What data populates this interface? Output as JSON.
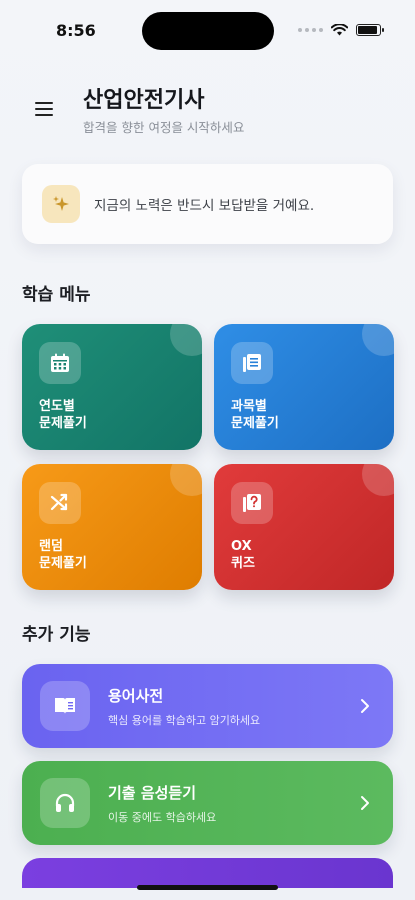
{
  "status_bar": {
    "time": "8:56",
    "icons": [
      "signal-icon",
      "wifi-icon",
      "battery-icon"
    ],
    "battery_level": 0.9
  },
  "header": {
    "title": "산업안전기사",
    "subtitle": "합격을 향한 여정을 시작하세요",
    "menu_icon": "menu-icon"
  },
  "quote": {
    "text": "지금의 노력은 반드시 보답받을 거예요.",
    "icon": "sparkles-icon",
    "icon_color": "#c9962b"
  },
  "study_menu": {
    "title": "학습 메뉴",
    "tiles": [
      {
        "label": "연도별\n문제풀기",
        "icon": "calendar-icon",
        "colors": [
          "#1f8f78",
          "#127466"
        ]
      },
      {
        "label": "과목별\n문제풀기",
        "icon": "book-list-icon",
        "colors": [
          "#2f8ee6",
          "#1d6fc4"
        ]
      },
      {
        "label": "랜덤\n문제풀기",
        "icon": "shuffle-icon",
        "colors": [
          "#f79a18",
          "#df7d00"
        ]
      },
      {
        "label": "OX\n퀴즈",
        "icon": "quiz-icon",
        "colors": [
          "#e13b3b",
          "#c02727"
        ]
      }
    ]
  },
  "extra": {
    "title": "추가 기능",
    "items": [
      {
        "title": "용어사전",
        "subtitle": "핵심 용어를 학습하고 암기하세요",
        "icon": "dictionary-icon",
        "colors": [
          "#6a63f0",
          "#7d78f6"
        ]
      },
      {
        "title": "기출 음성듣기",
        "subtitle": "이동 중에도 학습하세요",
        "icon": "headphones-icon",
        "colors": [
          "#4caf50",
          "#5cba5f"
        ]
      }
    ]
  }
}
